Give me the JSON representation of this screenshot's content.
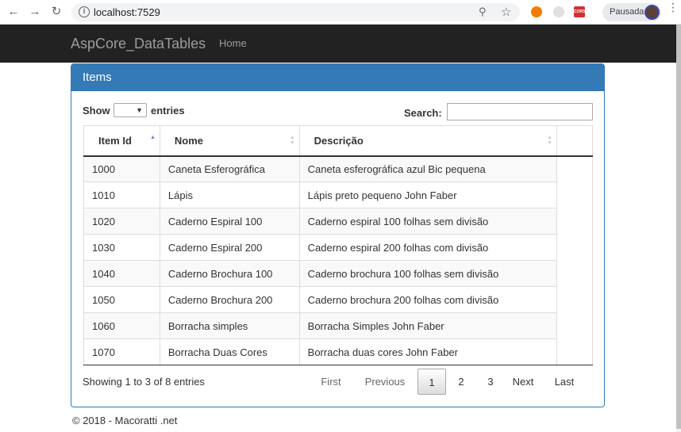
{
  "browser": {
    "url": "localhost:7529",
    "profile_label": "Pausada",
    "ext3_label": "CORS"
  },
  "navbar": {
    "brand": "AspCore_DataTables",
    "home": "Home"
  },
  "panel": {
    "title": "Items"
  },
  "controls": {
    "show_label": "Show",
    "entries_label": "entries",
    "search_label": "Search:",
    "length_value": "",
    "search_value": ""
  },
  "table": {
    "columns": [
      "Item Id",
      "Nome",
      "Descrição"
    ],
    "rows": [
      [
        "1000",
        "Caneta Esferográfica",
        "Caneta esferográfica azul Bic pequena"
      ],
      [
        "1010",
        "Lápis",
        "Lápis preto pequeno John Faber"
      ],
      [
        "1020",
        "Caderno Espiral 100",
        "Caderno espiral 100 folhas sem divisão"
      ],
      [
        "1030",
        "Caderno Espiral 200",
        "Caderno espiral 200 folhas com divisão"
      ],
      [
        "1040",
        "Caderno Brochura 100",
        "Caderno brochura 100 folhas sem divisão"
      ],
      [
        "1050",
        "Caderno Brochura 200",
        "Caderno brochura 200 folhas com divisão"
      ],
      [
        "1060",
        "Borracha simples",
        "Borracha Simples John Faber"
      ],
      [
        "1070",
        "Borracha Duas Cores",
        "Borracha duas cores John Faber"
      ]
    ]
  },
  "info": "Showing 1 to 3 of 8 entries",
  "pagination": {
    "first": "First",
    "previous": "Previous",
    "pages": [
      "1",
      "2",
      "3"
    ],
    "current_page": "1",
    "next": "Next",
    "last": "Last"
  },
  "footer": "© 2018 - Macoratti .net",
  "colors": {
    "panel_primary": "#337ab7",
    "navbar_bg": "#222222",
    "sort_active": "#7d7dd8"
  }
}
